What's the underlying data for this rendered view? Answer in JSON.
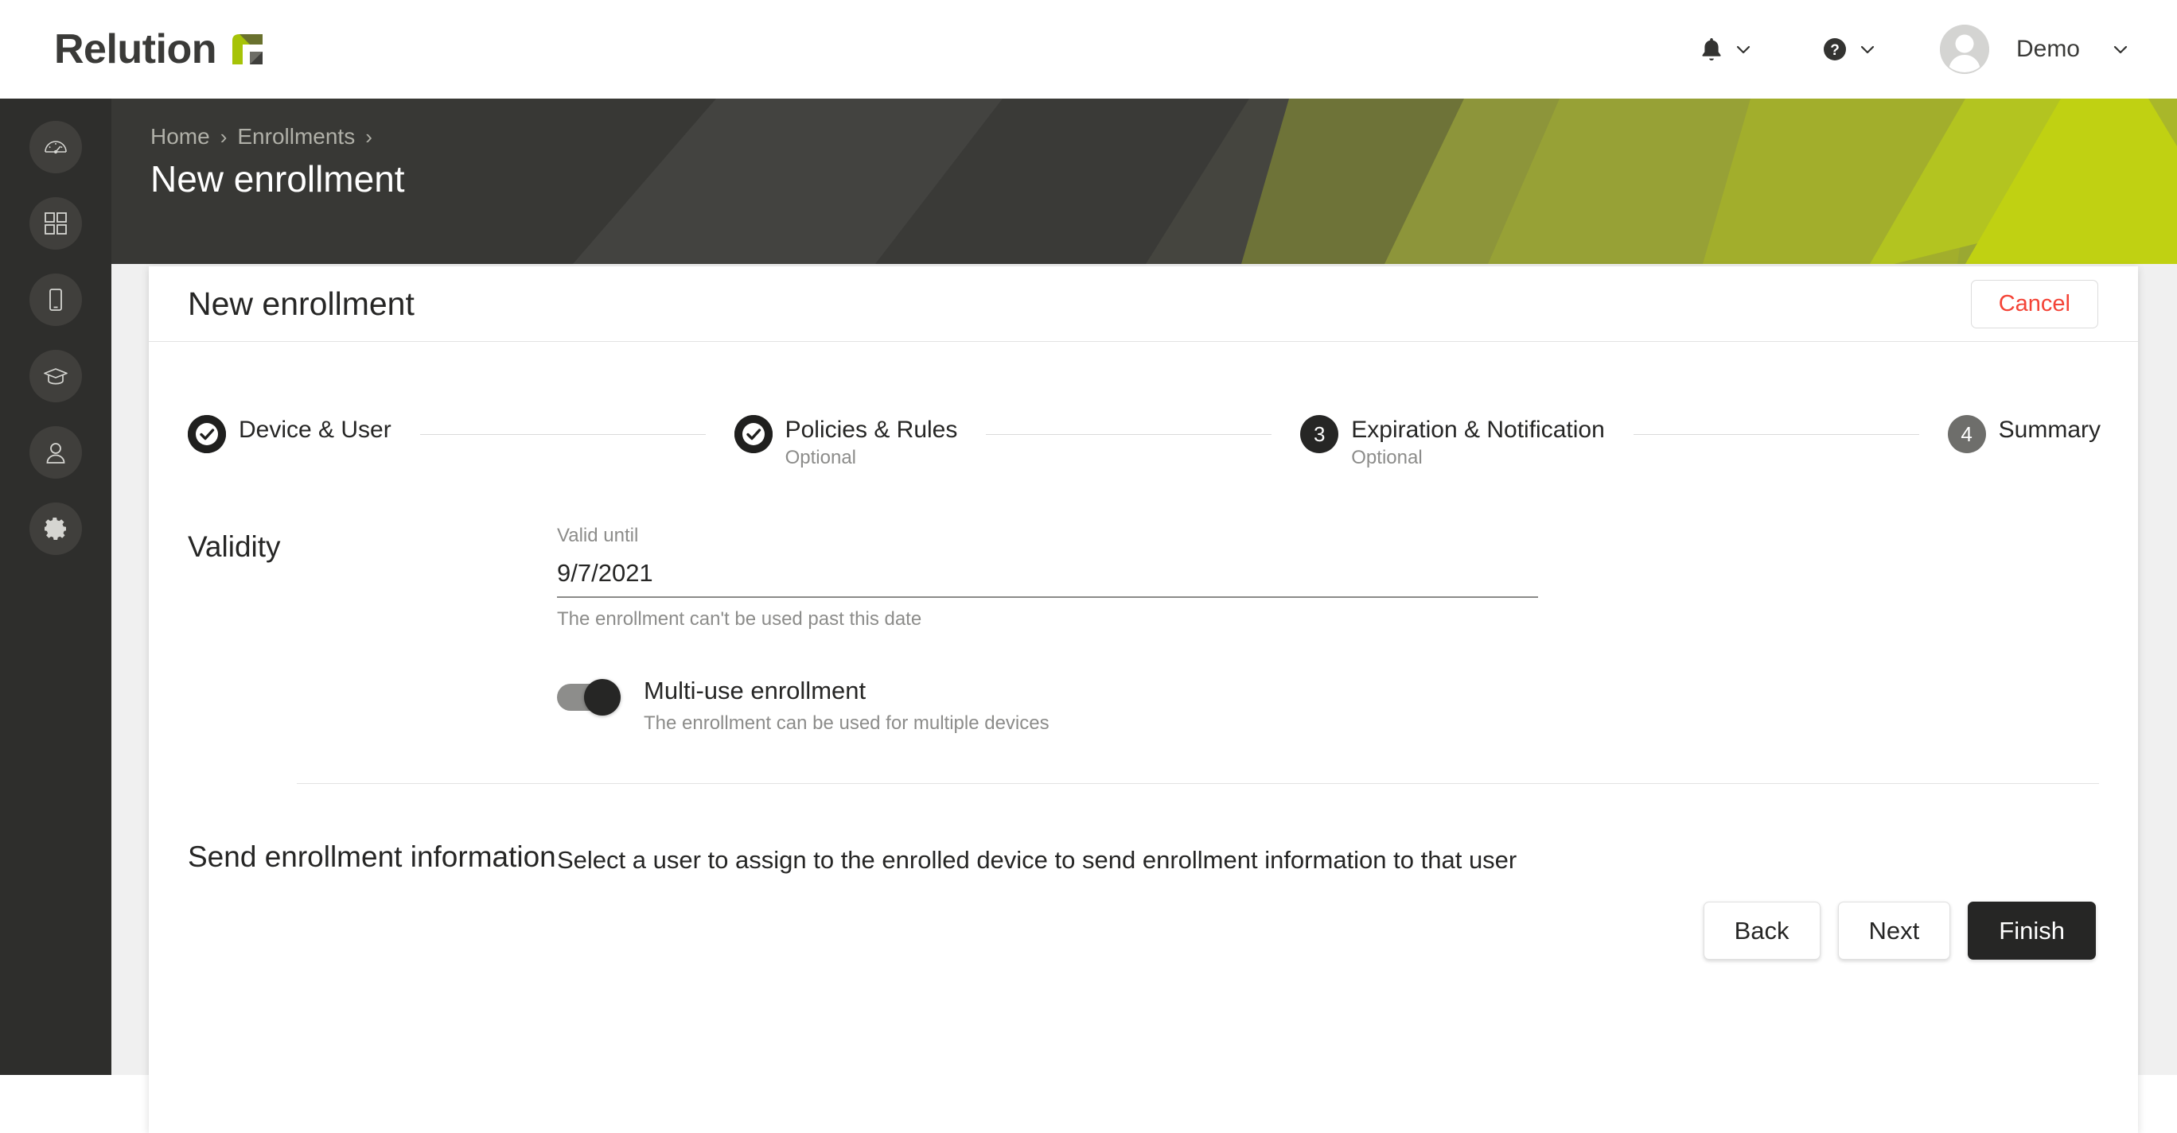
{
  "brand": {
    "name": "Relution",
    "logo_icon": "relution-r-mark",
    "green": "#A6C307",
    "dark": "#3A3A38"
  },
  "topbar": {
    "notifications_icon": "bell-icon",
    "notifications_chevron_icon": "chevron-down-icon",
    "help_icon": "help-circle-icon",
    "help_chevron_icon": "chevron-down-icon",
    "avatar_icon": "avatar-placeholder-icon",
    "user_name": "Demo",
    "user_chevron_icon": "chevron-down-icon"
  },
  "sidebar": {
    "items": [
      {
        "name": "dashboard",
        "icon": "gauge-icon"
      },
      {
        "name": "apps",
        "icon": "grid-apps-icon"
      },
      {
        "name": "devices",
        "icon": "smartphone-icon"
      },
      {
        "name": "education",
        "icon": "graduation-cap-icon"
      },
      {
        "name": "users",
        "icon": "user-icon"
      },
      {
        "name": "settings",
        "icon": "gear-icon"
      }
    ]
  },
  "banner": {
    "breadcrumb": [
      {
        "label": "Home"
      },
      {
        "label": "Enrollments"
      }
    ],
    "breadcrumb_separator": "›",
    "page_title": "New enrollment"
  },
  "card": {
    "title": "New enrollment",
    "cancel_label": "Cancel"
  },
  "stepper": {
    "steps": [
      {
        "label": "Device & User",
        "sub": "",
        "state": "done",
        "marker": "check"
      },
      {
        "label": "Policies & Rules",
        "sub": "Optional",
        "state": "done",
        "marker": "check"
      },
      {
        "label": "Expiration & Notification",
        "sub": "Optional",
        "state": "active",
        "marker": "3"
      },
      {
        "label": "Summary",
        "sub": "",
        "state": "todo",
        "marker": "4"
      }
    ]
  },
  "validity": {
    "legend": "Validity",
    "valid_until_label": "Valid until",
    "valid_until_value": "9/7/2021",
    "valid_until_placeholder": "M/D/YYYY",
    "valid_until_hint": "The enrollment can't be used past this date",
    "multi_use_label": "Multi-use enrollment",
    "multi_use_hint": "The enrollment can be used for multiple devices",
    "multi_use_on": true
  },
  "send_info": {
    "legend": "Send enrollment information",
    "description": "Select a user to assign to the enrolled device to send enrollment information to that user"
  },
  "actions": {
    "back_label": "Back",
    "next_label": "Next",
    "finish_label": "Finish"
  }
}
